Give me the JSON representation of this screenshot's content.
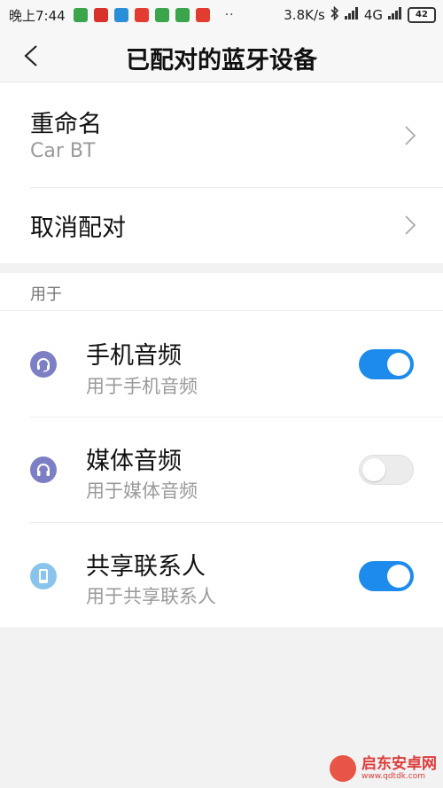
{
  "statusbar": {
    "time": "晚上7:44",
    "speed": "3.8K/s",
    "network": "4G",
    "battery": "42",
    "app_icons": [
      {
        "name": "app-icon-1",
        "color": "#3aa54a"
      },
      {
        "name": "app-icon-2",
        "color": "#d9322b"
      },
      {
        "name": "app-icon-3",
        "color": "#2a8fd8"
      },
      {
        "name": "app-icon-4",
        "color": "#e23b2f"
      },
      {
        "name": "app-icon-5",
        "color": "#3aa54a"
      },
      {
        "name": "app-icon-6",
        "color": "#3aa54a"
      },
      {
        "name": "app-icon-7",
        "color": "#e23b2f"
      }
    ],
    "dots": "··"
  },
  "header": {
    "title": "已配对的蓝牙设备"
  },
  "rename": {
    "label": "重命名",
    "value": "Car BT"
  },
  "unpair": {
    "label": "取消配对"
  },
  "section": {
    "label": "用于"
  },
  "profiles": [
    {
      "title": "手机音频",
      "subtitle": "用于手机音频",
      "enabled": true,
      "icon": "headset-icon"
    },
    {
      "title": "媒体音频",
      "subtitle": "用于媒体音频",
      "enabled": false,
      "icon": "headphones-icon"
    },
    {
      "title": "共享联系人",
      "subtitle": "用于共享联系人",
      "enabled": true,
      "icon": "phone-icon"
    }
  ],
  "colors": {
    "accent": "#1d8bec",
    "icon_purple": "#7d7fc5",
    "icon_blue": "#8ac4ec"
  },
  "watermark": {
    "text": "启东安卓网",
    "url": "www.qdtdk.com"
  }
}
